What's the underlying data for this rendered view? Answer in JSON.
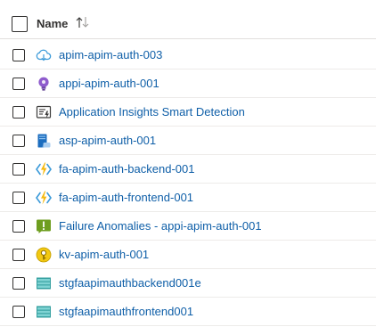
{
  "header": {
    "name_label": "Name"
  },
  "rows": [
    {
      "name": "apim-apim-auth-003",
      "icon": "api-management-cloud-icon"
    },
    {
      "name": "appi-apim-auth-001",
      "icon": "application-insights-bulb-icon"
    },
    {
      "name": "Application Insights Smart Detection",
      "icon": "action-group-icon"
    },
    {
      "name": "asp-apim-auth-001",
      "icon": "app-service-plan-icon"
    },
    {
      "name": "fa-apim-auth-backend-001",
      "icon": "function-app-icon"
    },
    {
      "name": "fa-apim-auth-frontend-001",
      "icon": "function-app-icon"
    },
    {
      "name": "Failure Anomalies - appi-apim-auth-001",
      "icon": "alert-rule-icon"
    },
    {
      "name": "kv-apim-auth-001",
      "icon": "key-vault-icon"
    },
    {
      "name": "stgfaapimauthbackend001e",
      "icon": "storage-account-icon"
    },
    {
      "name": "stgfaapimauthfrontend001",
      "icon": "storage-account-icon"
    }
  ]
}
